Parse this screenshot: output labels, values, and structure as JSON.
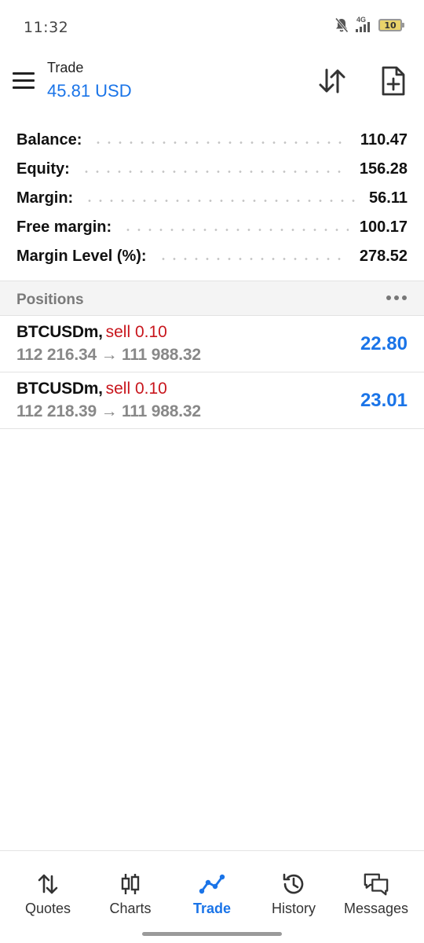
{
  "status_bar": {
    "time": "11:32",
    "network": "4G",
    "battery_level": "10",
    "icons": [
      "notifications-off-icon",
      "signal-icon",
      "battery-icon"
    ]
  },
  "header": {
    "title": "Trade",
    "balance": "45.81 USD",
    "icons": [
      "menu-icon",
      "sort-icon",
      "new-order-icon"
    ]
  },
  "summary": [
    {
      "label": "Balance:",
      "value": "110.47"
    },
    {
      "label": "Equity:",
      "value": "156.28"
    },
    {
      "label": "Margin:",
      "value": "56.11"
    },
    {
      "label": "Free margin:",
      "value": "100.17"
    },
    {
      "label": "Margin Level (%):",
      "value": "278.52"
    }
  ],
  "positions": {
    "title": "Positions",
    "items": [
      {
        "symbol": "BTCUSDm,",
        "side": "sell 0.10",
        "prices": "112 216.34 → 111 988.32",
        "profit": "22.80"
      },
      {
        "symbol": "BTCUSDm,",
        "side": "sell 0.10",
        "prices": "112 218.39 → 111 988.32",
        "profit": "23.01"
      }
    ]
  },
  "nav": [
    {
      "label": "Quotes",
      "icon": "quotes-icon",
      "active": false
    },
    {
      "label": "Charts",
      "icon": "charts-icon",
      "active": false
    },
    {
      "label": "Trade",
      "icon": "trade-icon",
      "active": true
    },
    {
      "label": "History",
      "icon": "history-icon",
      "active": false
    },
    {
      "label": "Messages",
      "icon": "messages-icon",
      "active": false
    }
  ],
  "colors": {
    "accent": "#1a74e8",
    "sell": "#c8161d",
    "muted": "#888888"
  }
}
